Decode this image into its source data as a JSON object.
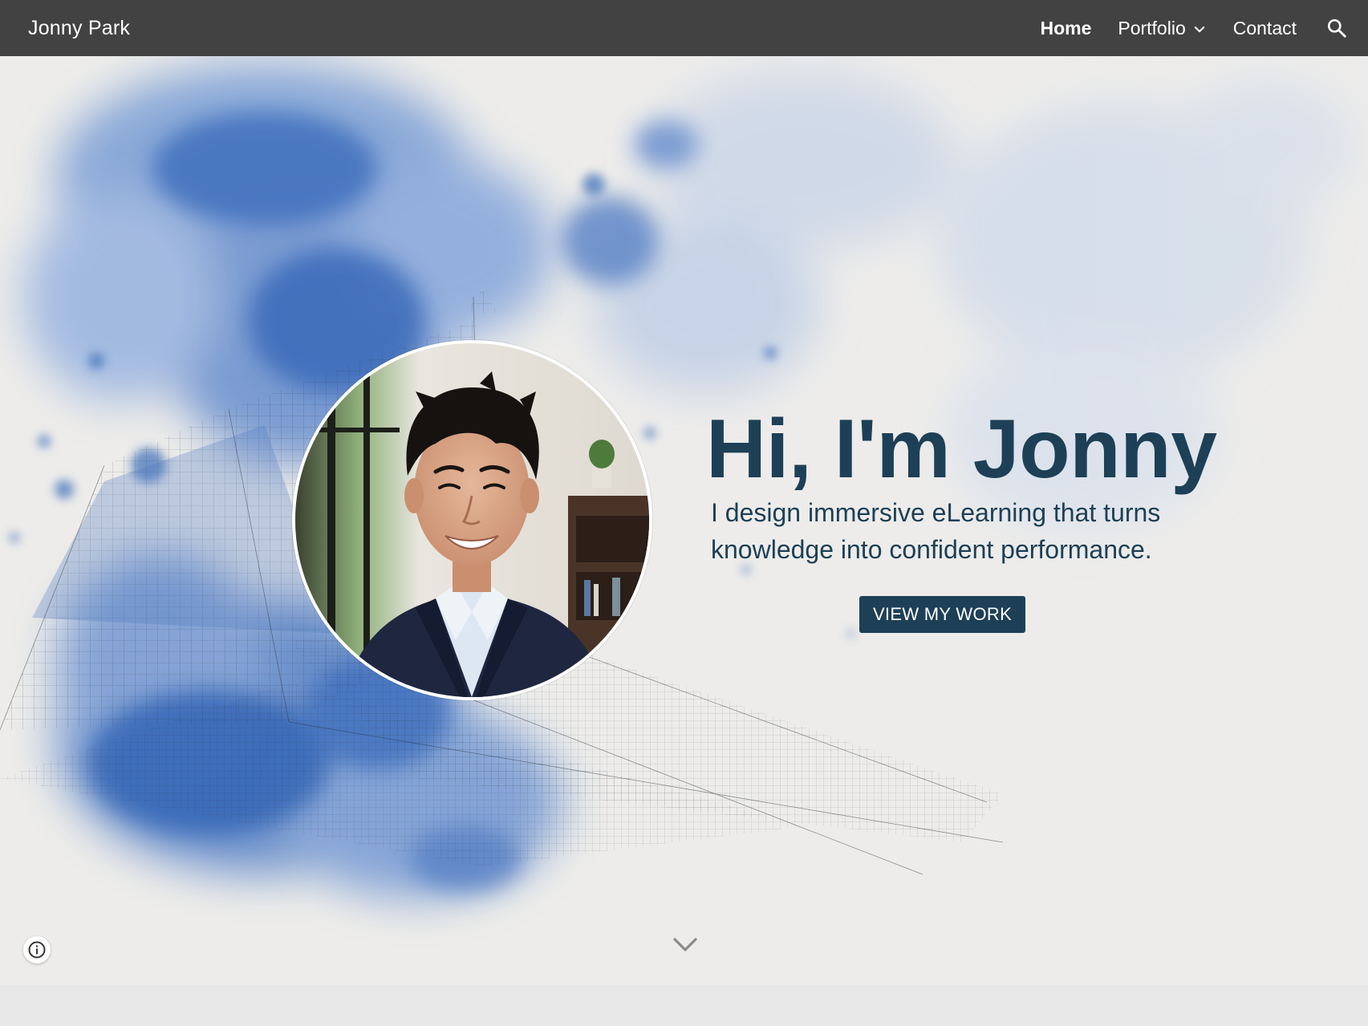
{
  "header": {
    "site_title": "Jonny Park",
    "nav": [
      {
        "label": "Home",
        "active": true
      },
      {
        "label": "Portfolio",
        "has_dropdown": true
      },
      {
        "label": "Contact"
      }
    ],
    "search_icon": "search-icon",
    "dropdown_icon": "chevron-down-icon"
  },
  "hero": {
    "headline": "Hi, I'm Jonny",
    "tagline_line1": "I design immersive eLearning that turns",
    "tagline_line2": "knowledge into confident performance.",
    "cta_label": "VIEW MY WORK",
    "scroll_icon": "chevron-down-icon",
    "portrait": "headshot photo of smiling man in navy blazer"
  },
  "footer": {
    "info_icon": "info-icon"
  },
  "colors": {
    "topbar": "#424242",
    "accent": "#1d4057",
    "watercolor_blue": "#3e6fb8",
    "background": "#ecebea"
  }
}
